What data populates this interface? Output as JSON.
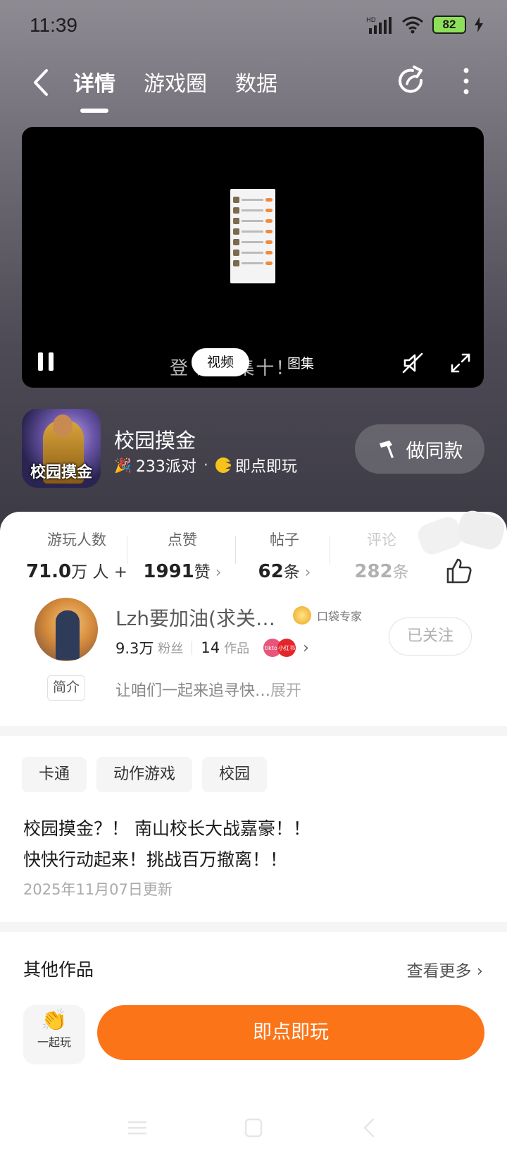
{
  "status_bar": {
    "time": "11:39",
    "network": "HD",
    "battery": "82"
  },
  "nav": {
    "tabs": [
      "详情",
      "游戏圈",
      "数据"
    ],
    "active_tab": 0
  },
  "video": {
    "subtitle": "登  游戏集十！",
    "segments": [
      "视频",
      "图集"
    ],
    "active_segment": 0
  },
  "game": {
    "icon_text": "校园摸金",
    "title": "校园摸金",
    "party_count": "233派对",
    "play_mode": "即点即玩",
    "make_same_label": "做同款"
  },
  "stats": [
    {
      "label": "游玩人数",
      "value": "71.0",
      "unit": "万 人 +"
    },
    {
      "label": "点赞",
      "value": "1991",
      "unit": "赞"
    },
    {
      "label": "帖子",
      "value": "62",
      "unit": "条"
    },
    {
      "label": "评论",
      "value": "282",
      "unit": "条"
    }
  ],
  "author": {
    "name": "Lzh要加油(求关…",
    "badge": "口袋专家",
    "fans": "9.3万",
    "fans_label": "粉丝",
    "works": "14",
    "works_label": "作品",
    "mini_badges": [
      "tiktok",
      "小红书"
    ],
    "follow_state": "已关注"
  },
  "intro": {
    "tag": "简介",
    "text": "让咱们一起来追寻快…",
    "more": "展开"
  },
  "tags": [
    "卡通",
    "动作游戏",
    "校园"
  ],
  "description": [
    "校园摸金？！ 南山校长大战嘉豪！！",
    "快快行动起来！挑战百万撤离！！"
  ],
  "updated": "2025年11月07日更新",
  "other_works": {
    "title": "其他作品",
    "more": "查看更多"
  },
  "bottom": {
    "play_together": "一起玩",
    "play_now": "即点即玩"
  },
  "colors": {
    "accent": "#fb7418",
    "battery": "#8ee05a"
  }
}
